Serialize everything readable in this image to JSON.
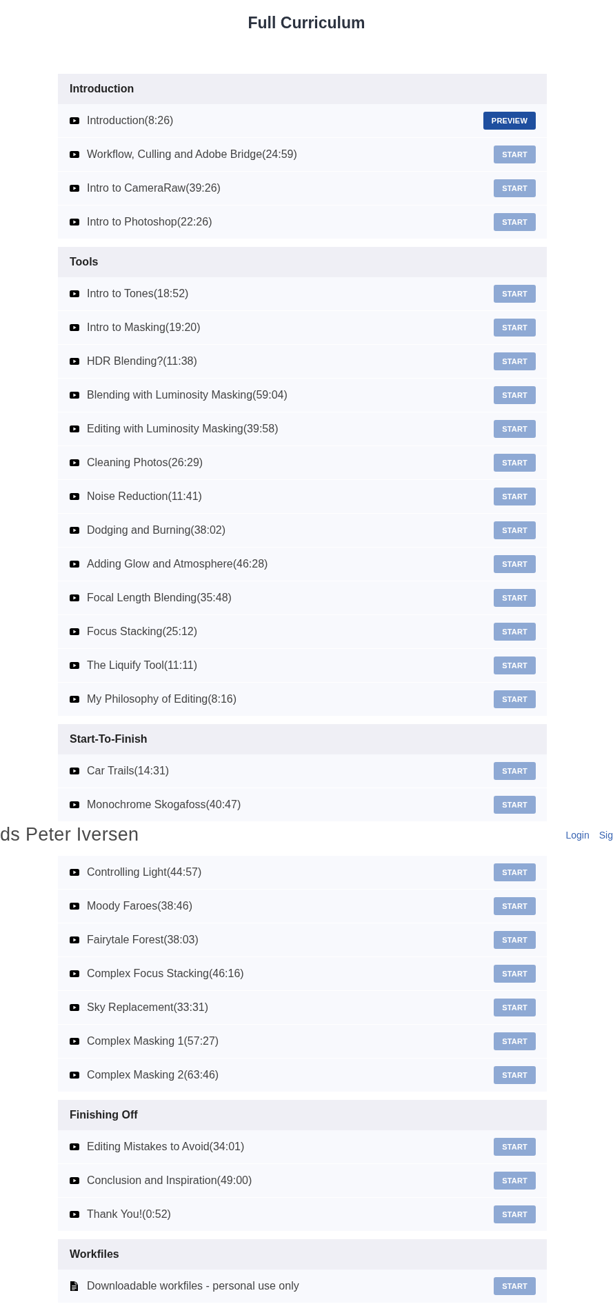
{
  "page_title": "Full Curriculum",
  "curriculum_top": {
    "sections": [
      {
        "title": "Introduction",
        "lectures": [
          {
            "kind": "video",
            "title": "Introduction(8:26)",
            "button": {
              "label": "PREVIEW",
              "disabled": false
            }
          },
          {
            "kind": "video",
            "title": "Workflow, Culling and Adobe Bridge(24:59)",
            "button": {
              "label": "START",
              "disabled": true
            }
          },
          {
            "kind": "video",
            "title": "Intro to CameraRaw(39:26)",
            "button": {
              "label": "START",
              "disabled": true
            }
          },
          {
            "kind": "video",
            "title": "Intro to Photoshop(22:26)",
            "button": {
              "label": "START",
              "disabled": true
            }
          }
        ]
      },
      {
        "title": "Tools",
        "lectures": [
          {
            "kind": "video",
            "title": "Intro to Tones(18:52)",
            "button": {
              "label": "START",
              "disabled": true
            }
          },
          {
            "kind": "video",
            "title": "Intro to Masking(19:20)",
            "button": {
              "label": "START",
              "disabled": true
            }
          },
          {
            "kind": "video",
            "title": "HDR Blending?(11:38)",
            "button": {
              "label": "START",
              "disabled": true
            }
          },
          {
            "kind": "video",
            "title": "Blending with Luminosity Masking(59:04)",
            "button": {
              "label": "START",
              "disabled": true
            }
          },
          {
            "kind": "video",
            "title": "Editing with Luminosity Masking(39:58)",
            "button": {
              "label": "START",
              "disabled": true
            }
          },
          {
            "kind": "video",
            "title": "Cleaning Photos(26:29)",
            "button": {
              "label": "START",
              "disabled": true
            }
          },
          {
            "kind": "video",
            "title": "Noise Reduction(11:41)",
            "button": {
              "label": "START",
              "disabled": true
            }
          },
          {
            "kind": "video",
            "title": "Dodging and Burning(38:02)",
            "button": {
              "label": "START",
              "disabled": true
            }
          },
          {
            "kind": "video",
            "title": "Adding Glow and Atmosphere(46:28)",
            "button": {
              "label": "START",
              "disabled": true
            }
          },
          {
            "kind": "video",
            "title": "Focal Length Blending(35:48)",
            "button": {
              "label": "START",
              "disabled": true
            }
          },
          {
            "kind": "video",
            "title": "Focus Stacking(25:12)",
            "button": {
              "label": "START",
              "disabled": true
            }
          },
          {
            "kind": "video",
            "title": "The Liquify Tool(11:11)",
            "button": {
              "label": "START",
              "disabled": true
            }
          },
          {
            "kind": "video",
            "title": "My Philosophy of Editing(8:16)",
            "button": {
              "label": "START",
              "disabled": true
            }
          }
        ]
      },
      {
        "title": "Start-To-Finish",
        "lectures": [
          {
            "kind": "video",
            "title": "Car Trails(14:31)",
            "button": {
              "label": "START",
              "disabled": true
            }
          },
          {
            "kind": "video",
            "title": "Monochrome Skogafoss(40:47)",
            "button": {
              "label": "START",
              "disabled": true
            }
          }
        ]
      }
    ]
  },
  "site_header": {
    "brand": "ds Peter Iversen",
    "links": [
      "Login",
      "Sig"
    ]
  },
  "curriculum_continued": {
    "sections": [
      {
        "lectures": [
          {
            "kind": "video",
            "title": "Controlling Light(44:57)",
            "button": {
              "label": "START",
              "disabled": true
            }
          },
          {
            "kind": "video",
            "title": "Moody Faroes(38:46)",
            "button": {
              "label": "START",
              "disabled": true
            }
          },
          {
            "kind": "video",
            "title": "Fairytale Forest(38:03)",
            "button": {
              "label": "START",
              "disabled": true
            }
          },
          {
            "kind": "video",
            "title": "Complex Focus Stacking(46:16)",
            "button": {
              "label": "START",
              "disabled": true
            }
          },
          {
            "kind": "video",
            "title": "Sky Replacement(33:31)",
            "button": {
              "label": "START",
              "disabled": true
            }
          },
          {
            "kind": "video",
            "title": "Complex Masking 1(57:27)",
            "button": {
              "label": "START",
              "disabled": true
            }
          },
          {
            "kind": "video",
            "title": "Complex Masking 2(63:46)",
            "button": {
              "label": "START",
              "disabled": true
            }
          }
        ]
      },
      {
        "title": "Finishing Off",
        "lectures": [
          {
            "kind": "video",
            "title": "Editing Mistakes to Avoid(34:01)",
            "button": {
              "label": "START",
              "disabled": true
            }
          },
          {
            "kind": "video",
            "title": "Conclusion and Inspiration(49:00)",
            "button": {
              "label": "START",
              "disabled": true
            }
          },
          {
            "kind": "video",
            "title": "Thank You!(0:52)",
            "button": {
              "label": "START",
              "disabled": true
            }
          }
        ]
      },
      {
        "title": "Workfiles",
        "lectures": [
          {
            "kind": "file",
            "title": "Downloadable workfiles - personal use only",
            "button": {
              "label": "START",
              "disabled": true
            }
          }
        ]
      }
    ]
  }
}
